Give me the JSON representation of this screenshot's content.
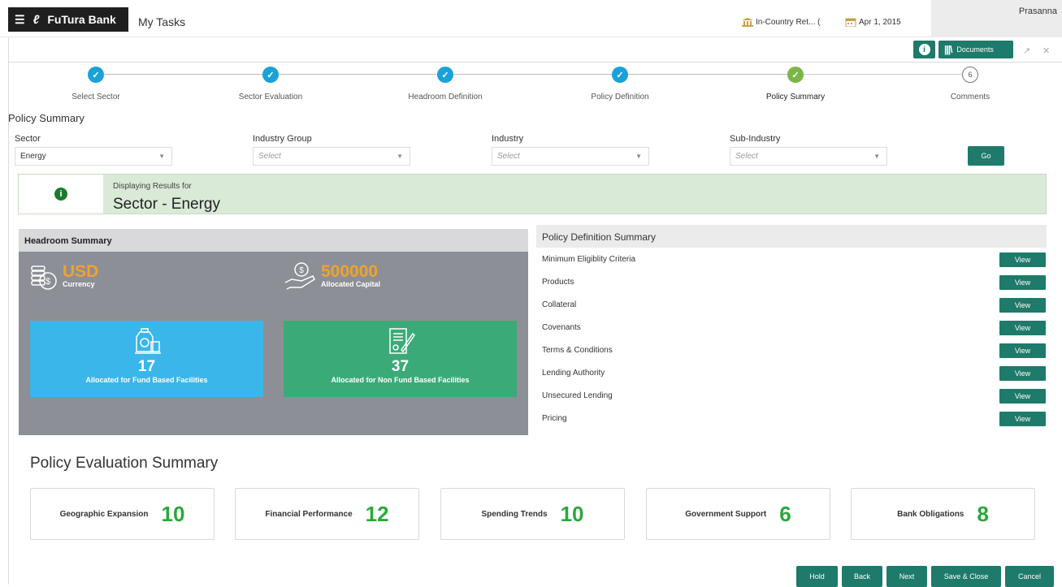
{
  "topbar": {
    "brand": "FuTura Bank",
    "app_title": "My Tasks",
    "entity": "In-Country Ret... (",
    "date": "Apr 1, 2015",
    "user": "Prasanna"
  },
  "actions": {
    "documents": "Documents",
    "info": "i"
  },
  "steps": [
    {
      "label": "Select Sector",
      "state": "done"
    },
    {
      "label": "Sector Evaluation",
      "state": "done"
    },
    {
      "label": "Headroom Definition",
      "state": "done"
    },
    {
      "label": "Policy Definition",
      "state": "done"
    },
    {
      "label": "Policy Summary",
      "state": "active"
    },
    {
      "label": "Comments",
      "state": "todo",
      "number": "6"
    }
  ],
  "page_title": "Policy Summary",
  "filters": {
    "sector": {
      "label": "Sector",
      "value": "Energy"
    },
    "industry_group": {
      "label": "Industry Group",
      "placeholder": "Select"
    },
    "industry": {
      "label": "Industry",
      "placeholder": "Select"
    },
    "sub_industry": {
      "label": "Sub-Industry",
      "placeholder": "Select"
    },
    "go": "Go"
  },
  "banner": {
    "subtitle": "Displaying Results for",
    "title": "Sector - Energy"
  },
  "headroom": {
    "title": "Headroom Summary",
    "currency_value": "USD",
    "currency_label": "Currency",
    "capital_value": "500000",
    "capital_label": "Allocated Capital",
    "fund_value": "17",
    "fund_label": "Allocated for Fund Based Facilities",
    "nonfund_value": "37",
    "nonfund_label": "Allocated for Non Fund Based Facilities",
    "fund_color": "#3ab6ea",
    "nonfund_color": "#3aab78"
  },
  "policy_definition": {
    "title": "Policy Definition Summary",
    "view_label": "View",
    "items": [
      "Minimum Eligiblity Criteria",
      "Products",
      "Collateral",
      "Covenants",
      "Terms & Conditions",
      "Lending Authority",
      "Unsecured Lending",
      "Pricing"
    ]
  },
  "evaluation": {
    "title": "Policy Evaluation Summary",
    "cards": [
      {
        "name": "Geographic Expansion",
        "value": "10"
      },
      {
        "name": "Financial Performance",
        "value": "12"
      },
      {
        "name": "Spending Trends",
        "value": "10"
      },
      {
        "name": "Government Support",
        "value": "6"
      },
      {
        "name": "Bank Obligations",
        "value": "8"
      }
    ]
  },
  "footer": {
    "hold": "Hold",
    "back": "Back",
    "next": "Next",
    "save_close": "Save & Close",
    "cancel": "Cancel"
  }
}
